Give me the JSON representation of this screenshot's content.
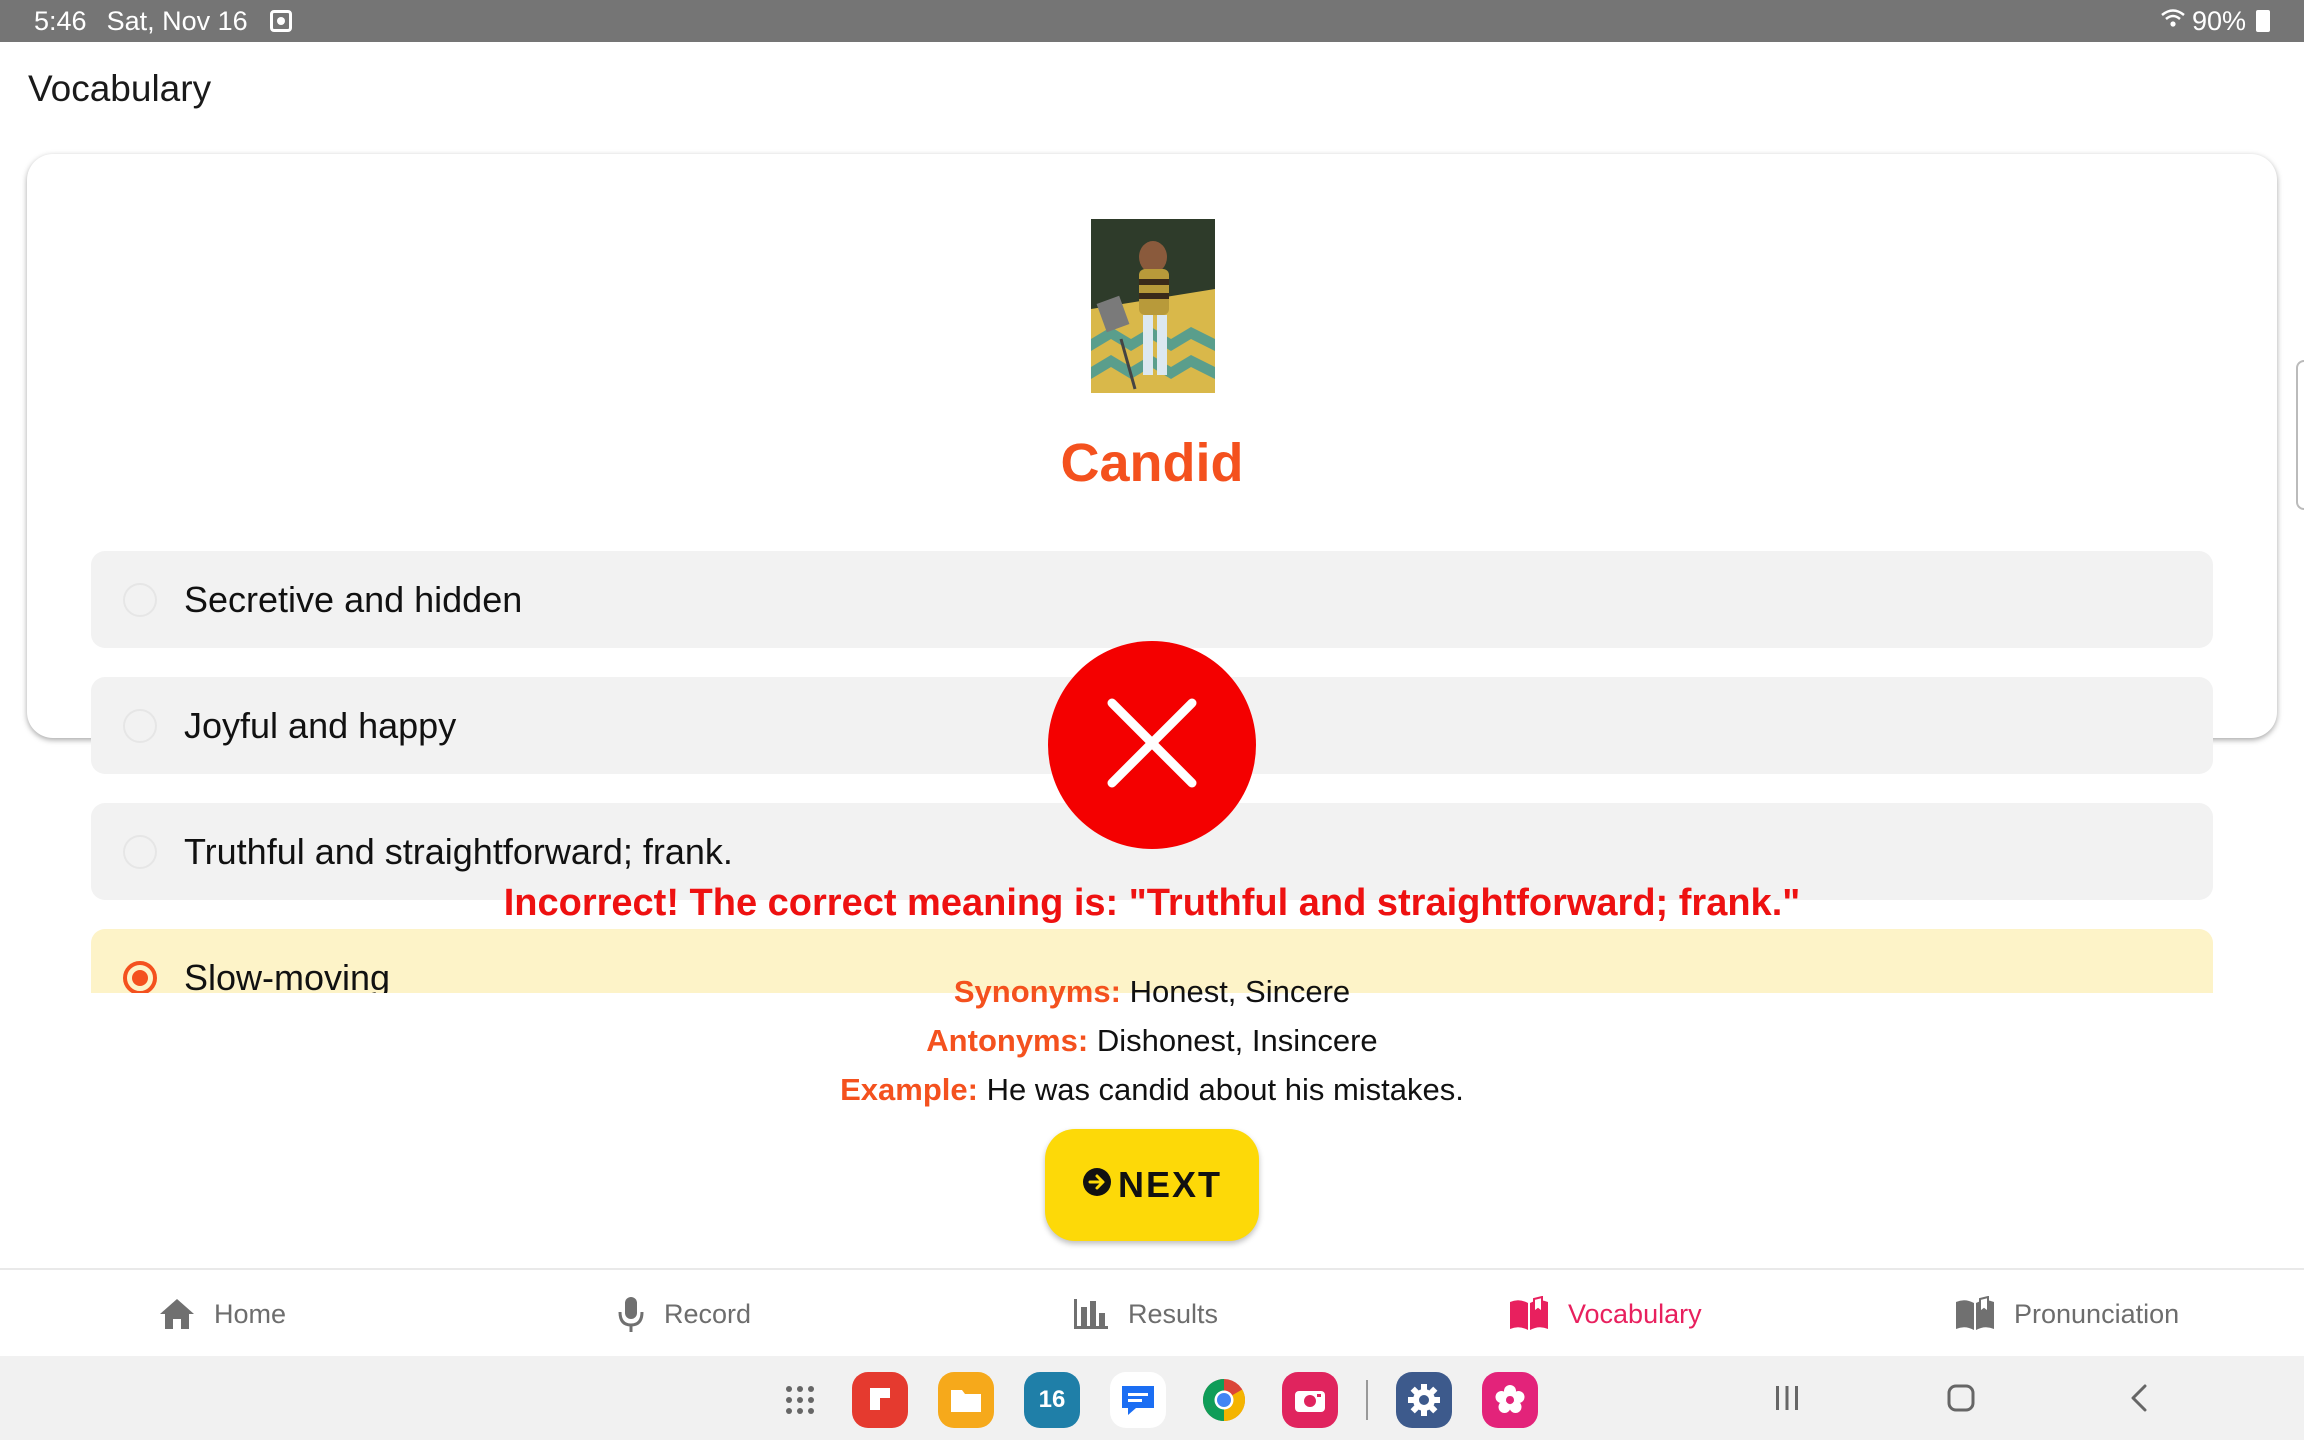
{
  "status_bar": {
    "time": "5:46",
    "date": "Sat, Nov 16",
    "battery": "90%"
  },
  "app": {
    "title": "Vocabulary"
  },
  "quiz": {
    "word": "Candid",
    "options": [
      {
        "label": "Secretive and hidden",
        "selected": false
      },
      {
        "label": "Joyful and happy",
        "selected": false
      },
      {
        "label": "Truthful and straightforward; frank.",
        "selected": false
      },
      {
        "label": "Slow-moving",
        "selected": true
      }
    ],
    "feedback": {
      "icon": "close-icon",
      "message": "Incorrect! The correct meaning is: \"Truthful and straightforward; frank.\"",
      "synonyms_label": "Synonyms:",
      "synonyms": "Honest, Sincere",
      "antonyms_label": "Antonyms:",
      "antonyms": "Dishonest, Insincere",
      "example_label": "Example:",
      "example": "He was candid about his mistakes."
    },
    "next_label": "NEXT"
  },
  "bottom_nav": {
    "items": [
      {
        "label": "Home",
        "icon": "home-icon",
        "active": false
      },
      {
        "label": "Record",
        "icon": "microphone-icon",
        "active": false
      },
      {
        "label": "Results",
        "icon": "bar-chart-icon",
        "active": false
      },
      {
        "label": "Vocabulary",
        "icon": "book-icon",
        "active": true
      },
      {
        "label": "Pronunciation",
        "icon": "book-icon",
        "active": false
      }
    ]
  },
  "system_dock": {
    "calendar_day": "16"
  },
  "colors": {
    "accent_orange": "#f4511e",
    "error_red": "#f40000",
    "active_pink": "#e8205e",
    "next_yellow": "#fdd908",
    "selected_bg": "#fdf3c8"
  }
}
